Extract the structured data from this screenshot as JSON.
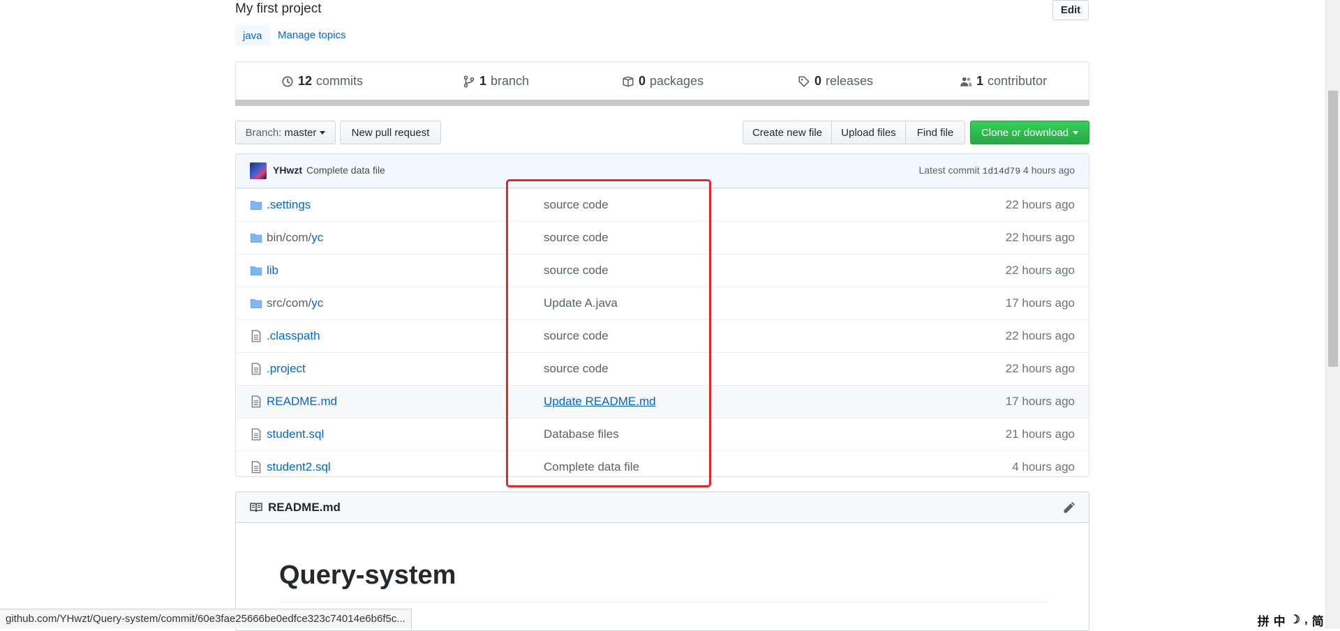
{
  "repo": {
    "description": "My first project",
    "edit_label": "Edit",
    "topics": [
      "java"
    ],
    "manage_topics_label": "Manage topics"
  },
  "summary": {
    "commits": {
      "count": "12",
      "label": "commits"
    },
    "branches": {
      "count": "1",
      "label": "branch"
    },
    "packages": {
      "count": "0",
      "label": "packages"
    },
    "releases": {
      "count": "0",
      "label": "releases"
    },
    "contributors": {
      "count": "1",
      "label": "contributor"
    }
  },
  "nav": {
    "branch_label": "Branch:",
    "branch_value": "master",
    "new_pull_request": "New pull request",
    "create_new_file": "Create new file",
    "upload_files": "Upload files",
    "find_file": "Find file",
    "clone_or_download": "Clone or download"
  },
  "latest_commit": {
    "author": "YHwzt",
    "message": "Complete data file",
    "prefix": "Latest commit",
    "sha": "1d14d79",
    "age": "4 hours ago"
  },
  "files": [
    {
      "type": "dir",
      "name": ".settings",
      "name_dim": "",
      "message": "source code",
      "age": "22 hours ago"
    },
    {
      "type": "dir",
      "name": "yc",
      "name_dim": "bin/com/",
      "message": "source code",
      "age": "22 hours ago"
    },
    {
      "type": "dir",
      "name": "lib",
      "name_dim": "",
      "message": "source code",
      "age": "22 hours ago"
    },
    {
      "type": "dir",
      "name": "yc",
      "name_dim": "src/com/",
      "message": "Update A.java",
      "age": "17 hours ago"
    },
    {
      "type": "file",
      "name": ".classpath",
      "name_dim": "",
      "message": "source code",
      "age": "22 hours ago"
    },
    {
      "type": "file",
      "name": ".project",
      "name_dim": "",
      "message": "source code",
      "age": "22 hours ago"
    },
    {
      "type": "file",
      "name": "README.md",
      "name_dim": "",
      "message": "Update README.md",
      "age": "17 hours ago"
    },
    {
      "type": "file",
      "name": "student.sql",
      "name_dim": "",
      "message": "Database files",
      "age": "21 hours ago"
    },
    {
      "type": "file",
      "name": "student2.sql",
      "name_dim": "",
      "message": "Complete data file",
      "age": "4 hours ago"
    }
  ],
  "readme": {
    "title": "README.md",
    "heading": "Query-system"
  },
  "status_url": "github.com/YHwzt/Query-system/commit/60e3fae25666be0edfce323c74014e6b6f5c...",
  "ime": {
    "a": "拼",
    "b": "中",
    "c": "简"
  },
  "colors": {
    "link": "#0366d6",
    "green": "#28a745",
    "annotation_red": "#e5262d"
  }
}
